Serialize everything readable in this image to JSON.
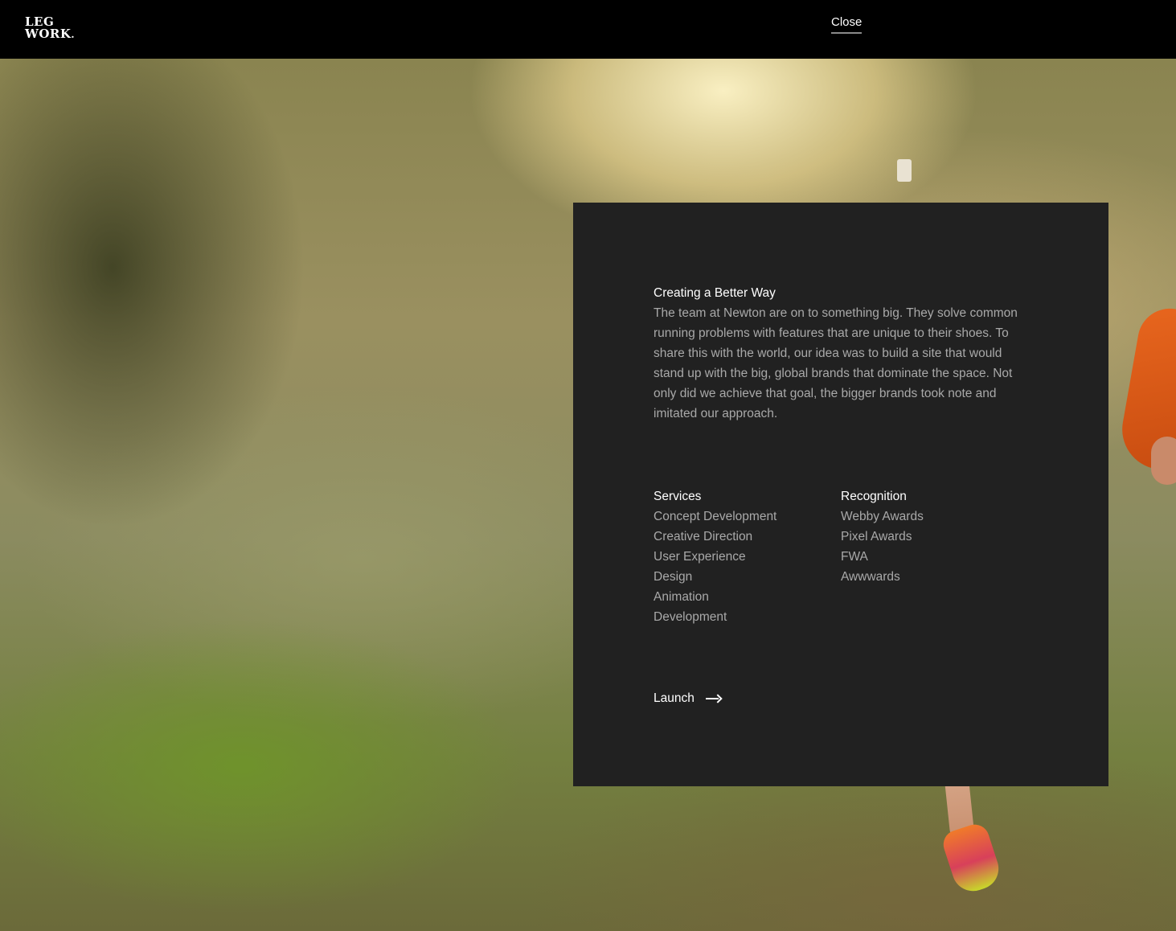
{
  "header": {
    "logo_line1": "LEG",
    "logo_line2": "WORK",
    "logo_dot": ".",
    "close_label": "Close"
  },
  "panel": {
    "heading": "Creating a Better Way",
    "description": "The team at Newton are on to something big. They solve common running problems with features that are unique to their shoes. To share this with the world, our idea was to build a site that would stand up with the big, global brands that dominate the space. Not only did we achieve that goal, the bigger brands took note and imitated our approach.",
    "services": {
      "title": "Services",
      "items": [
        "Concept Development",
        "Creative Direction",
        "User Experience",
        "Design",
        "Animation",
        "Development"
      ]
    },
    "recognition": {
      "title": "Recognition",
      "items": [
        "Webby Awards",
        "Pixel Awards",
        "FWA",
        "Awwwards"
      ]
    },
    "launch_label": "Launch",
    "launch_icon": "arrow-right-icon"
  },
  "colors": {
    "topbar": "#000000",
    "panel": "#212121",
    "heading_text": "#ffffff",
    "body_text": "#a9a9a9",
    "runner_shirt": "#e8661e"
  }
}
